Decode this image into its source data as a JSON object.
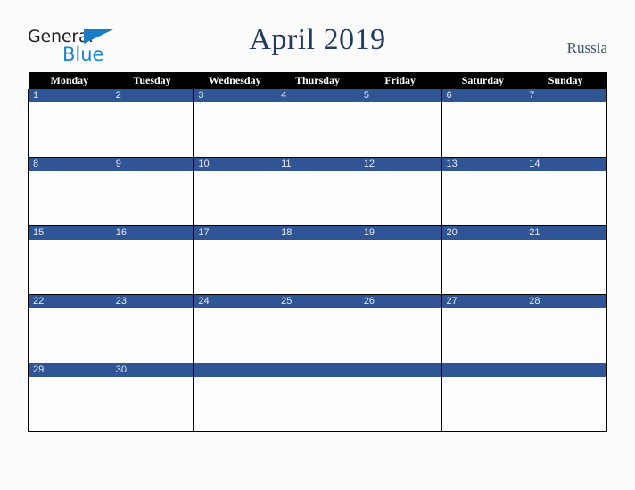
{
  "logo": {
    "word_one": "General",
    "word_two": "Blue",
    "triangle_icon": "triangle-icon",
    "accent_color": "#1b86d0"
  },
  "header": {
    "title": "April 2019",
    "country": "Russia",
    "title_color": "#223a63"
  },
  "calendar": {
    "weekday_headers": [
      "Monday",
      "Tuesday",
      "Wednesday",
      "Thursday",
      "Friday",
      "Saturday",
      "Sunday"
    ],
    "header_bg": "#000000",
    "daynum_bg": "#2f5596",
    "cell_bg": "#fdfdfd",
    "weeks": [
      [
        "1",
        "2",
        "3",
        "4",
        "5",
        "6",
        "7"
      ],
      [
        "8",
        "9",
        "10",
        "11",
        "12",
        "13",
        "14"
      ],
      [
        "15",
        "16",
        "17",
        "18",
        "19",
        "20",
        "21"
      ],
      [
        "22",
        "23",
        "24",
        "25",
        "26",
        "27",
        "28"
      ],
      [
        "29",
        "30",
        "",
        "",
        "",
        "",
        ""
      ]
    ]
  }
}
